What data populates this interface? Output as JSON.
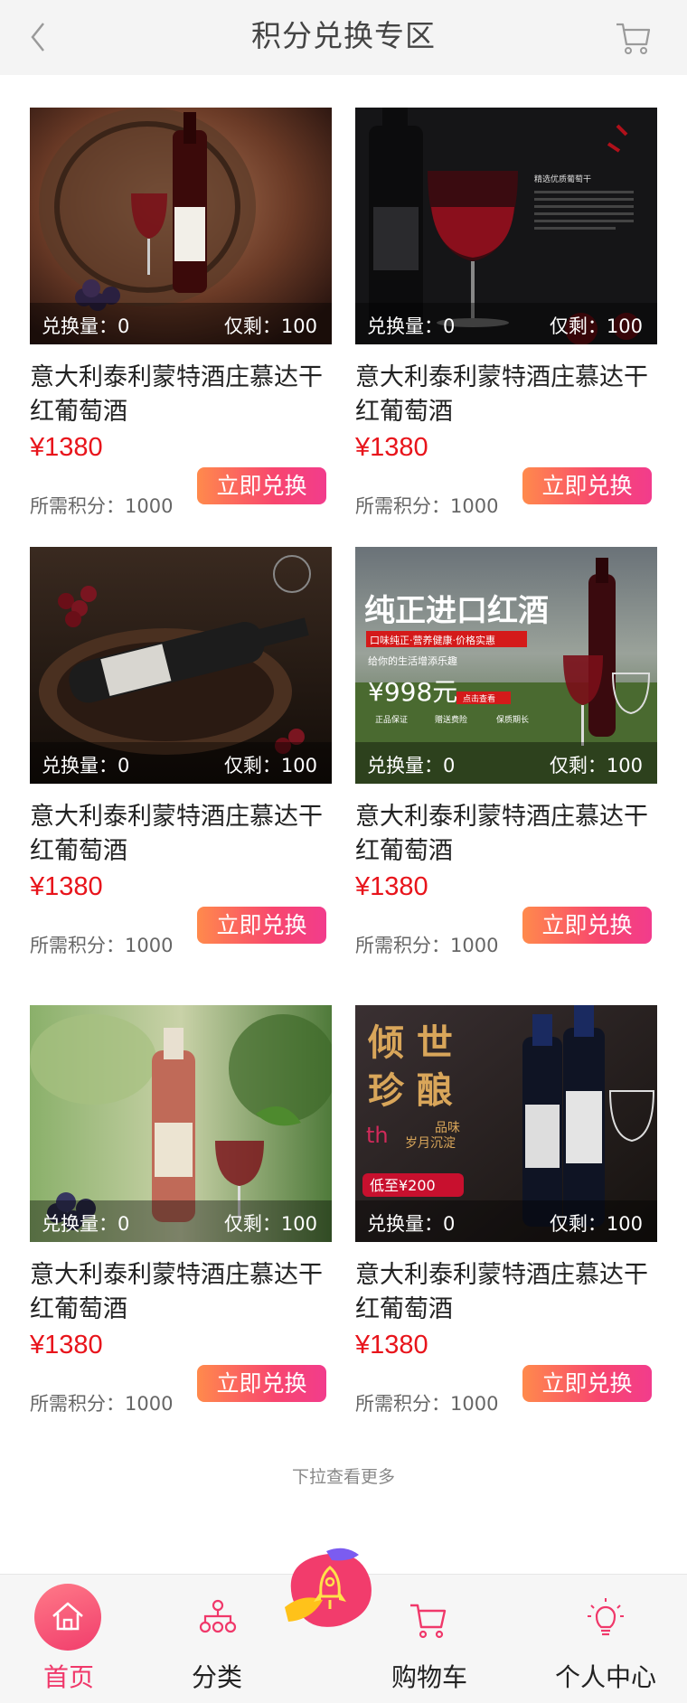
{
  "header": {
    "title": "积分兑换专区",
    "back_icon": "chevron-left-icon",
    "cart_icon": "cart-icon"
  },
  "products": [
    {
      "name": "意大利泰利蒙特酒庄慕达干红葡萄酒",
      "price": "¥1380",
      "points_label": "所需积分：1000",
      "exchanged": "兑换量：0",
      "remaining": "仅剩：100",
      "button": "立即兑换"
    },
    {
      "name": "意大利泰利蒙特酒庄慕达干红葡萄酒",
      "price": "¥1380",
      "points_label": "所需积分：1000",
      "exchanged": "兑换量：0",
      "remaining": "仅剩：100",
      "button": "立即兑换"
    },
    {
      "name": "意大利泰利蒙特酒庄慕达干红葡萄酒",
      "price": "¥1380",
      "points_label": "所需积分：1000",
      "exchanged": "兑换量：0",
      "remaining": "仅剩：100",
      "button": "立即兑换"
    },
    {
      "name": "意大利泰利蒙特酒庄慕达干红葡萄酒",
      "price": "¥1380",
      "points_label": "所需积分：1000",
      "exchanged": "兑换量：0",
      "remaining": "仅剩：100",
      "button": "立即兑换"
    },
    {
      "name": "意大利泰利蒙特酒庄慕达干红葡萄酒",
      "price": "¥1380",
      "points_label": "所需积分：1000",
      "exchanged": "兑换量：0",
      "remaining": "仅剩：100",
      "button": "立即兑换"
    },
    {
      "name": "意大利泰利蒙特酒庄慕达干红葡萄酒",
      "price": "¥1380",
      "points_label": "所需积分：1000",
      "exchanged": "兑换量：0",
      "remaining": "仅剩：100",
      "button": "立即兑换"
    }
  ],
  "banners": {
    "p2_small": "精选优质葡萄干",
    "p4_headline": "纯正进口红酒",
    "p4_tagline": "口味纯正·营养健康·价格实惠",
    "p4_sub": "给你的生活增添乐趣",
    "p4_price": "¥998元",
    "p4_cta": "点击查看",
    "p4_badges": [
      "正品保证",
      "赠送费险",
      "保质期长"
    ],
    "p6_line1": "倾 世",
    "p6_line2": "珍 酿",
    "p6_slogan1": "品味",
    "p6_slogan2": "岁月沉淀",
    "p6_price": "低至¥200"
  },
  "more_hint": "下拉查看更多",
  "tabs": [
    {
      "label": "首页",
      "icon": "home-icon",
      "active": true
    },
    {
      "label": "分类",
      "icon": "category-icon",
      "active": false
    },
    {
      "label": "购物车",
      "icon": "cart-icon",
      "active": false
    },
    {
      "label": "个人中心",
      "icon": "lightbulb-icon",
      "active": false
    }
  ],
  "floating_icon": "rocket-icon",
  "colors": {
    "accent": "#f0386a",
    "price": "#e8141b",
    "button_start": "#ff8a4c",
    "button_end": "#f23c8c"
  }
}
